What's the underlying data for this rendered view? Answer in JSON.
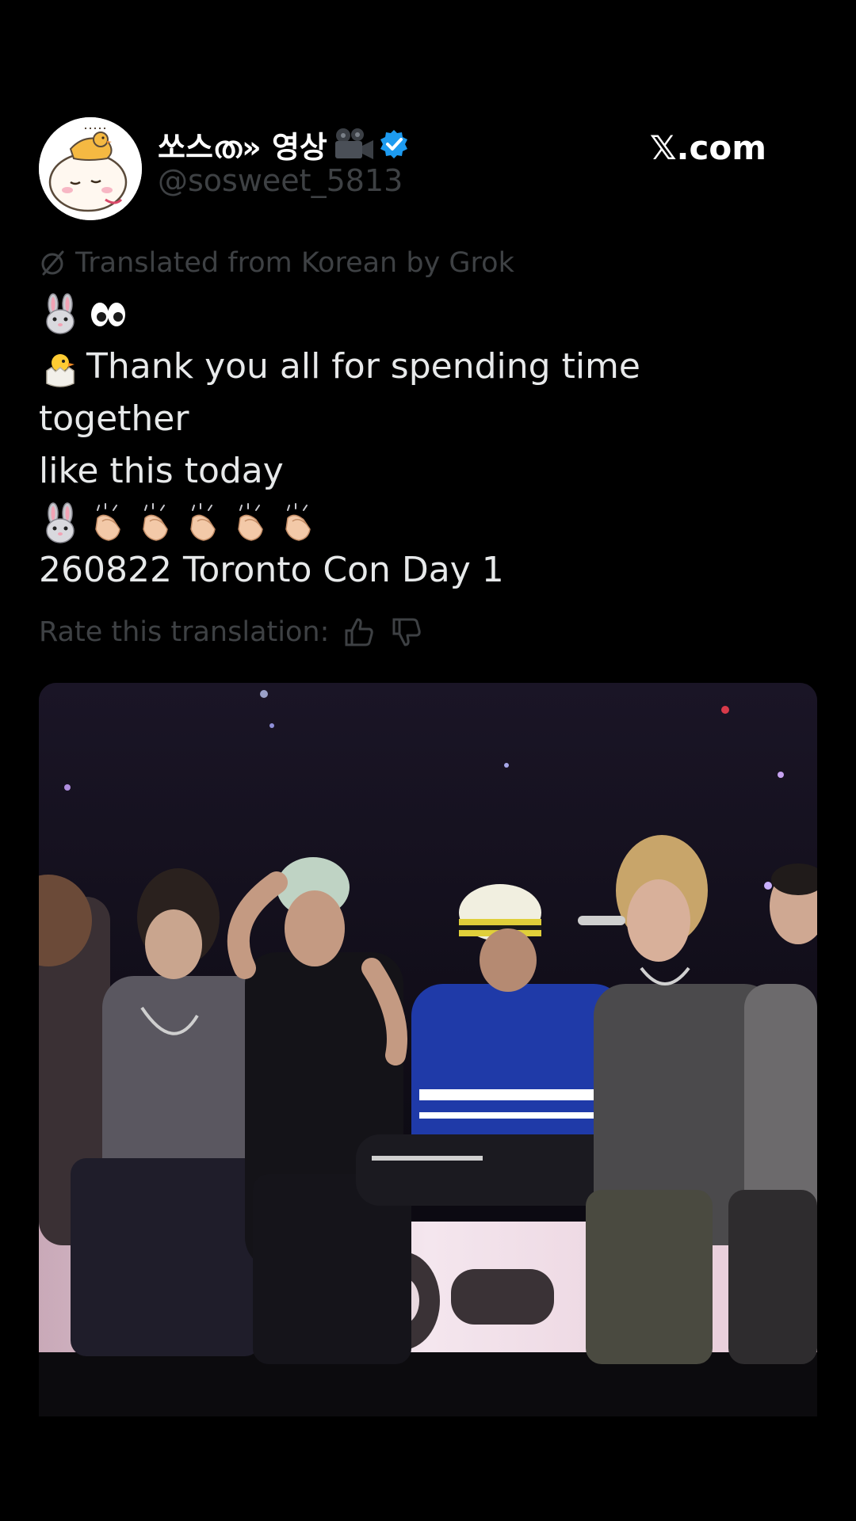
{
  "post": {
    "display_name": "쏘스ത» 영상",
    "handle": "@sosweet_5813",
    "brand": "𝕏.com",
    "translated_note": "Translated from Korean by Grok",
    "body_lines": [
      {
        "emojis": [
          "rabbit-face",
          "eyes"
        ],
        "text": ""
      },
      {
        "emojis": [
          "hatching-chick"
        ],
        "text": " Thank you all for spending time together"
      },
      {
        "emojis": [],
        "text": "like this today"
      },
      {
        "emojis": [
          "rabbit-face",
          "clapping-hands",
          "clapping-hands",
          "clapping-hands",
          "clapping-hands",
          "clapping-hands"
        ],
        "text": ""
      }
    ],
    "body_text_1": "Thank you all for spending time together",
    "body_text_2": "like this today",
    "event_line": "260822 Toronto Con Day 1",
    "rate_label": "Rate this translation:"
  },
  "icons": {
    "avatar": "cartoon-character-avatar",
    "camera": "movie-camera-icon",
    "verified": "verified-badge-icon",
    "grok": "grok-icon",
    "thumbs_up": "thumbs-up-icon",
    "thumbs_down": "thumbs-down-icon"
  },
  "colors": {
    "background": "#000000",
    "text_primary": "#e7e9ea",
    "text_muted": "#3e4144",
    "verified_blue": "#1d9bf0"
  }
}
